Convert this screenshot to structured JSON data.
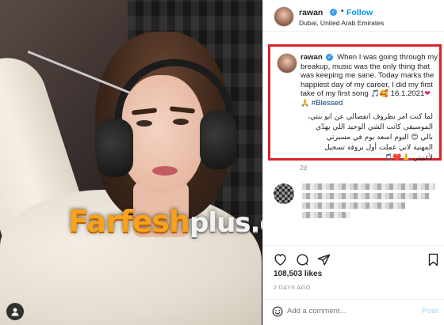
{
  "header": {
    "username": "rawan",
    "separator": "•",
    "follow_label": "Follow",
    "location": "Dubai, United Arab Emirates"
  },
  "photo": {
    "watermark_main": "Farfesh",
    "watermark_suffix": "plus.com"
  },
  "caption": {
    "username": "rawan",
    "text_en": "When I was going through my breakup, music was the only thing that was keeping me sane. Today marks the happiest day of my career, I did my first take of my first song",
    "date_line": "16.1.2021",
    "hashtag": "#Blessed",
    "ar_line1": "لما كنت امر بظروف انفصالي عن ابو بنتي،",
    "ar_line2": "الموسيقى كانت الشي الوحيد اللي يهدّي",
    "ar_line3": "بالي 😊 اليوم اسعد يوم في مسيرتي",
    "ar_line4": "المهنية لاني عملت أول بروفة تسجيل",
    "ar_line5": "لأغنيتي 🙏❤️🎵",
    "age": "2d"
  },
  "stats": {
    "likes": "108,503 likes",
    "posted": "2 DAYS AGO"
  },
  "comment_box": {
    "placeholder": "Add a comment...",
    "post_label": "Post"
  },
  "icons": {
    "verified": "verified-badge-icon",
    "like": "heart-icon",
    "comment": "speech-bubble-icon",
    "share": "paper-plane-icon",
    "save": "bookmark-icon",
    "emoji": "smiley-icon",
    "tag": "person-tag-icon"
  },
  "colors": {
    "accent": "#0095f6",
    "highlight_border": "#d8222a",
    "watermark": "#f6a21c"
  }
}
